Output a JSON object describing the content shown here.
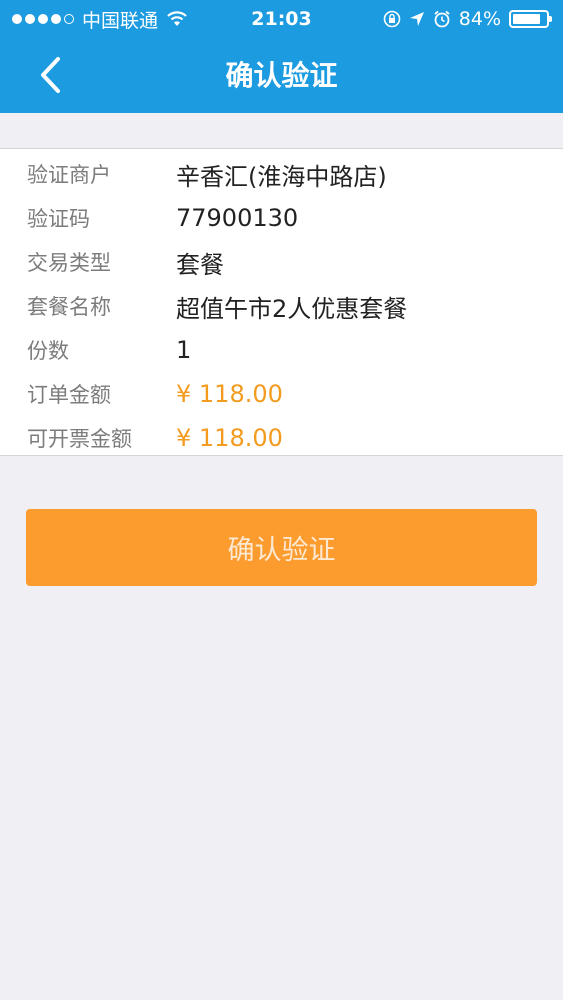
{
  "status_bar": {
    "carrier": "中国联通",
    "time": "21:03",
    "battery": "84%",
    "battery_level": 0.84,
    "icons": [
      "signal-dots-icon",
      "wifi-icon",
      "rotation-lock-icon",
      "location-arrow-icon",
      "alarm-icon",
      "battery-icon"
    ]
  },
  "nav": {
    "title": "确认验证",
    "back_icon": "chevron-left-icon"
  },
  "details": {
    "rows": [
      {
        "label": "验证商户",
        "value": "辛香汇(淮海中路店)"
      },
      {
        "label": "验证码",
        "value": "77900130"
      },
      {
        "label": "交易类型",
        "value": "套餐"
      },
      {
        "label": "套餐名称",
        "value": "超值午市2人优惠套餐"
      },
      {
        "label": "份数",
        "value": "1"
      },
      {
        "label": "订单金额",
        "value": "¥ 118.00"
      },
      {
        "label": "可开票金额",
        "value": "¥ 118.00"
      }
    ]
  },
  "confirm_button": {
    "label": "确认验证"
  },
  "colors": {
    "header": "#1c9be0",
    "background": "#efeff4",
    "button": "#fc9c2e",
    "price": "#f39b1f"
  }
}
